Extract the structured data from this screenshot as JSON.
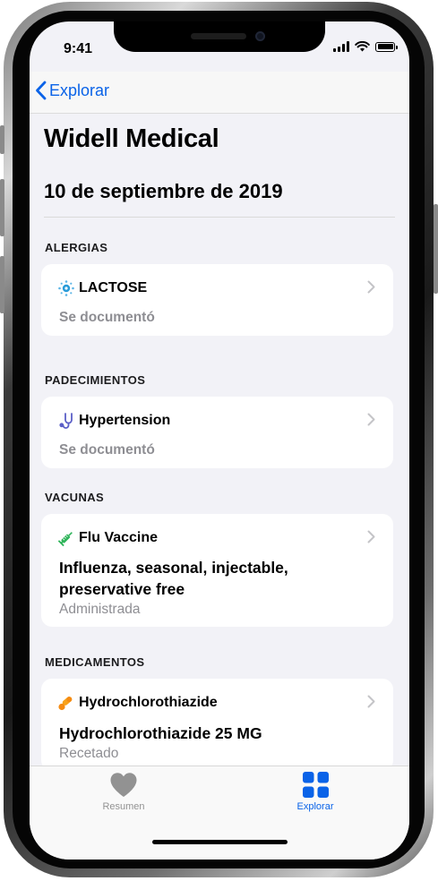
{
  "status_bar": {
    "time": "9:41"
  },
  "nav": {
    "back_label": "Explorar"
  },
  "page": {
    "title": "Widell Medical",
    "date": "10 de septiembre de 2019"
  },
  "sections": [
    {
      "header": "ALERGIAS",
      "card": {
        "title": "LACTOSE",
        "icon": "allergy-icon",
        "status": "Se documentó"
      }
    },
    {
      "header": "PADECIMIENTOS",
      "card": {
        "title": "Hypertension",
        "icon": "stethoscope-icon",
        "status": "Se documentó"
      }
    },
    {
      "header": "VACUNAS",
      "card": {
        "title": "Flu Vaccine",
        "icon": "syringe-icon",
        "detail_line1": "Influenza, seasonal, injectable,",
        "detail_line2": "preservative free",
        "status": "Administrada"
      }
    },
    {
      "header": "MEDICAMENTOS",
      "card": {
        "title": "Hydrochlorothiazide",
        "icon": "pills-icon",
        "detail_line1": "Hydrochlorothiazide 25 MG",
        "status": "Recetado"
      }
    }
  ],
  "tabbar": {
    "tabs": [
      {
        "label": "Resumen",
        "icon": "heart-icon",
        "active": false
      },
      {
        "label": "Explorar",
        "icon": "grid-icon",
        "active": true
      }
    ]
  },
  "colors": {
    "accent": "#0a63e8",
    "background": "#f2f2f7",
    "card": "#ffffff",
    "secondary_text": "#8e8e93",
    "inactive_tab": "#929292"
  }
}
